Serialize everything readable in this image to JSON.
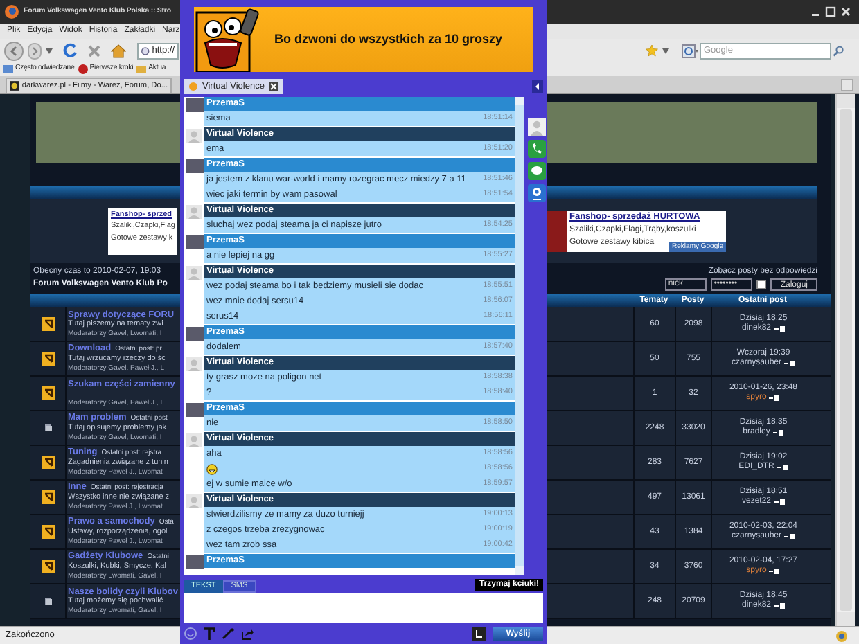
{
  "browser": {
    "title": "Forum Volkswagen Vento Klub Polska :: Stro",
    "menu": [
      "Plik",
      "Edycja",
      "Widok",
      "Historia",
      "Zakładki",
      "Narz"
    ],
    "url": "http://",
    "search_placeholder": "Google",
    "bookmarks": [
      "Często odwiedzane",
      "Pierwsze kroki",
      "Aktua"
    ],
    "tabs": [
      {
        "label": "darkwarez.pl - Filmy - Warez, Forum, Do...",
        "selected": false
      }
    ],
    "status": "Zakończono"
  },
  "forum": {
    "left_ad": {
      "title": "Fanshop- sprzed",
      "lines": [
        "Szaliki,Czapki,Flag",
        "Gotowe zestawy k"
      ]
    },
    "right_ad": {
      "title": "Fanshop- sprzedaż HURTOWA",
      "lines": [
        "Szaliki,Czapki,Flagi,Trąby,koszulki",
        "Gotowe zestawy kibica"
      ],
      "badge": "Reklamy Google"
    },
    "time": "Obecny czas to 2010-02-07, 19:03",
    "forum_title": "Forum Volkswagen Vento Klub Po",
    "unanswered_link": "Zobacz posty bez odpowiedzi",
    "login": {
      "username": "nick",
      "password": "••••••••",
      "remember": false,
      "button": "Zaloguj"
    },
    "columns": [
      "Tematy",
      "Posty",
      "Ostatni post"
    ],
    "rows": [
      {
        "name": "Sprawy dotyczące FORU",
        "description": "Tutaj piszemy na tematy zwi",
        "moderators": "Moderatorzy Gavel, Lwomati, I",
        "topics": "60",
        "posts": "2098",
        "last_date": "Dzisiaj 18:25",
        "last_user": "dinek82",
        "color": "#c8d0e0",
        "new_posts": true
      },
      {
        "name": "Download",
        "last_post": "Ostatni post: pr",
        "description": "Tutaj wrzucamy rzeczy do śc",
        "moderators": "Moderatorzy Gavel, Paweł J., L",
        "topics": "50",
        "posts": "755",
        "last_date": "Wczoraj 19:39",
        "last_user": "czarnysauber",
        "color": "#c8d0e0",
        "new_posts": true
      },
      {
        "name": "Szukam części zamienny",
        "moderators": "Moderatorzy Gavel, Paweł J., L",
        "topics": "1",
        "posts": "32",
        "last_date": "2010-01-26, 23:48",
        "last_user": "spyro",
        "color": "#e0803a",
        "new_posts": true
      },
      {
        "name": "Mam problem",
        "last_post": "Ostatni post",
        "description": "Tutaj opisujemy problemy jak",
        "moderators": "Moderatorzy Gavel, Lwomati, I",
        "topics": "2248",
        "posts": "33020",
        "last_date": "Dzisiaj 18:35",
        "last_user": "bradley",
        "color": "#c8d0e0",
        "new_posts": false
      },
      {
        "name": "Tuning",
        "last_post": "Ostatni post: rejstra",
        "description": "Zagadnienia związane z tunin",
        "moderators": "Moderatorzy Paweł J., Lwomat",
        "topics": "283",
        "posts": "7627",
        "last_date": "Dzisiaj 19:02",
        "last_user": "EDI_DTR",
        "color": "#c8d0e0",
        "new_posts": true
      },
      {
        "name": "Inne",
        "last_post": "Ostatni post: rejestracja",
        "description": "Wszystko inne nie związane z",
        "moderators": "Moderatorzy Paweł J., Lwomat",
        "topics": "497",
        "posts": "13061",
        "last_date": "Dzisiaj 18:51",
        "last_user": "vezet22",
        "color": "#c8d0e0",
        "new_posts": true
      },
      {
        "name": "Prawo a samochody",
        "last_post": "Osta",
        "description": "Ustawy, rozporządzenia, ogól",
        "moderators": "Moderatorzy Paweł J., Lwomat",
        "topics": "43",
        "posts": "1384",
        "last_date": "2010-02-03, 22:04",
        "last_user": "czarnysauber",
        "color": "#c8d0e0",
        "new_posts": true
      },
      {
        "name": "Gadżety Klubowe",
        "last_post": "Ostatni",
        "description": "Koszulki, Kubki, Smycze, Kal",
        "moderators": "Moderatorzy Lwomati, Gavel, I",
        "topics": "34",
        "posts": "3760",
        "last_date": "2010-02-04, 17:27",
        "last_user": "spyro",
        "color": "#e0803a",
        "new_posts": true
      },
      {
        "name": "Nasze bolidy czyli Klubov",
        "description": "Tutaj możemy się pochwalić",
        "moderators": "Moderatorzy Lwomati, Gavel, I",
        "topics": "248",
        "posts": "20709",
        "last_date": "Dzisiaj 18:45",
        "last_user": "dinek82",
        "color": "#c8d0e0",
        "new_posts": false
      }
    ]
  },
  "chat": {
    "banner": "Bo dzwoni do wszystkich za 10 groszy",
    "tab": "Virtual Violence",
    "groups": [
      {
        "author": "PrzemaS",
        "kind": "contact",
        "messages": [
          {
            "kind": "text",
            "text": "siema",
            "time": "18:51:14"
          }
        ]
      },
      {
        "author": "Virtual Violence",
        "kind": "own",
        "messages": [
          {
            "kind": "text",
            "text": "ema",
            "time": "18:51:20"
          }
        ]
      },
      {
        "author": "PrzemaS",
        "kind": "contact",
        "messages": [
          {
            "kind": "text",
            "text": "ja jestem z klanu war-world i mamy rozegrac mecz miedzy 7 a 11",
            "time": "18:51:46"
          },
          {
            "kind": "text",
            "text": "wiec jaki termin by wam pasowal",
            "time": "18:51:54"
          }
        ]
      },
      {
        "author": "Virtual Violence",
        "kind": "own",
        "messages": [
          {
            "kind": "text",
            "text": "sluchaj wez podaj steama ja ci napisze jutro",
            "time": "18:54:25"
          }
        ]
      },
      {
        "author": "PrzemaS",
        "kind": "contact",
        "messages": [
          {
            "kind": "text",
            "text": "a nie lepiej na gg",
            "time": "18:55:27"
          }
        ]
      },
      {
        "author": "Virtual Violence",
        "kind": "own",
        "messages": [
          {
            "kind": "text",
            "text": "wez podaj steama bo i tak bedziemy musieli sie dodac",
            "time": "18:55:51"
          },
          {
            "kind": "text",
            "text": "wez mnie dodaj sersu14",
            "time": "18:56:07"
          },
          {
            "kind": "text",
            "text": "serus14",
            "time": "18:56:11"
          }
        ]
      },
      {
        "author": "PrzemaS",
        "kind": "contact",
        "messages": [
          {
            "kind": "text",
            "text": "dodalem",
            "time": "18:57:40"
          }
        ]
      },
      {
        "author": "Virtual Violence",
        "kind": "own",
        "messages": [
          {
            "kind": "text",
            "text": "ty grasz moze na poligon net",
            "time": "18:58:38"
          },
          {
            "kind": "text",
            "text": "?",
            "time": "18:58:40"
          }
        ]
      },
      {
        "author": "PrzemaS",
        "kind": "contact",
        "messages": [
          {
            "kind": "text",
            "text": "nie",
            "time": "18:58:50"
          }
        ]
      },
      {
        "author": "Virtual Violence",
        "kind": "own",
        "messages": [
          {
            "kind": "text",
            "text": "aha",
            "time": "18:58:56"
          },
          {
            "kind": "emoticon",
            "time": "18:58:56"
          },
          {
            "kind": "text",
            "text": "ej w sumie maice w/o",
            "time": "18:59:57"
          }
        ]
      },
      {
        "author": "Virtual Violence",
        "kind": "own",
        "messages": [
          {
            "kind": "text",
            "text": "stwierdzilismy ze mamy za duzo turniejj",
            "time": "19:00:13"
          },
          {
            "kind": "text",
            "text": "z czegos trzeba zrezygnowac",
            "time": "19:00:19"
          },
          {
            "kind": "text",
            "text": "wez tam zrob ssa",
            "time": "19:00:42"
          }
        ]
      },
      {
        "author": "PrzemaS",
        "kind": "contact"
      }
    ],
    "input_tabs": [
      {
        "label": "TEKST",
        "selected": true
      },
      {
        "label": "SMS",
        "selected": false
      }
    ],
    "hint": "Trzymaj kciuki!",
    "send": "Wyślij"
  }
}
